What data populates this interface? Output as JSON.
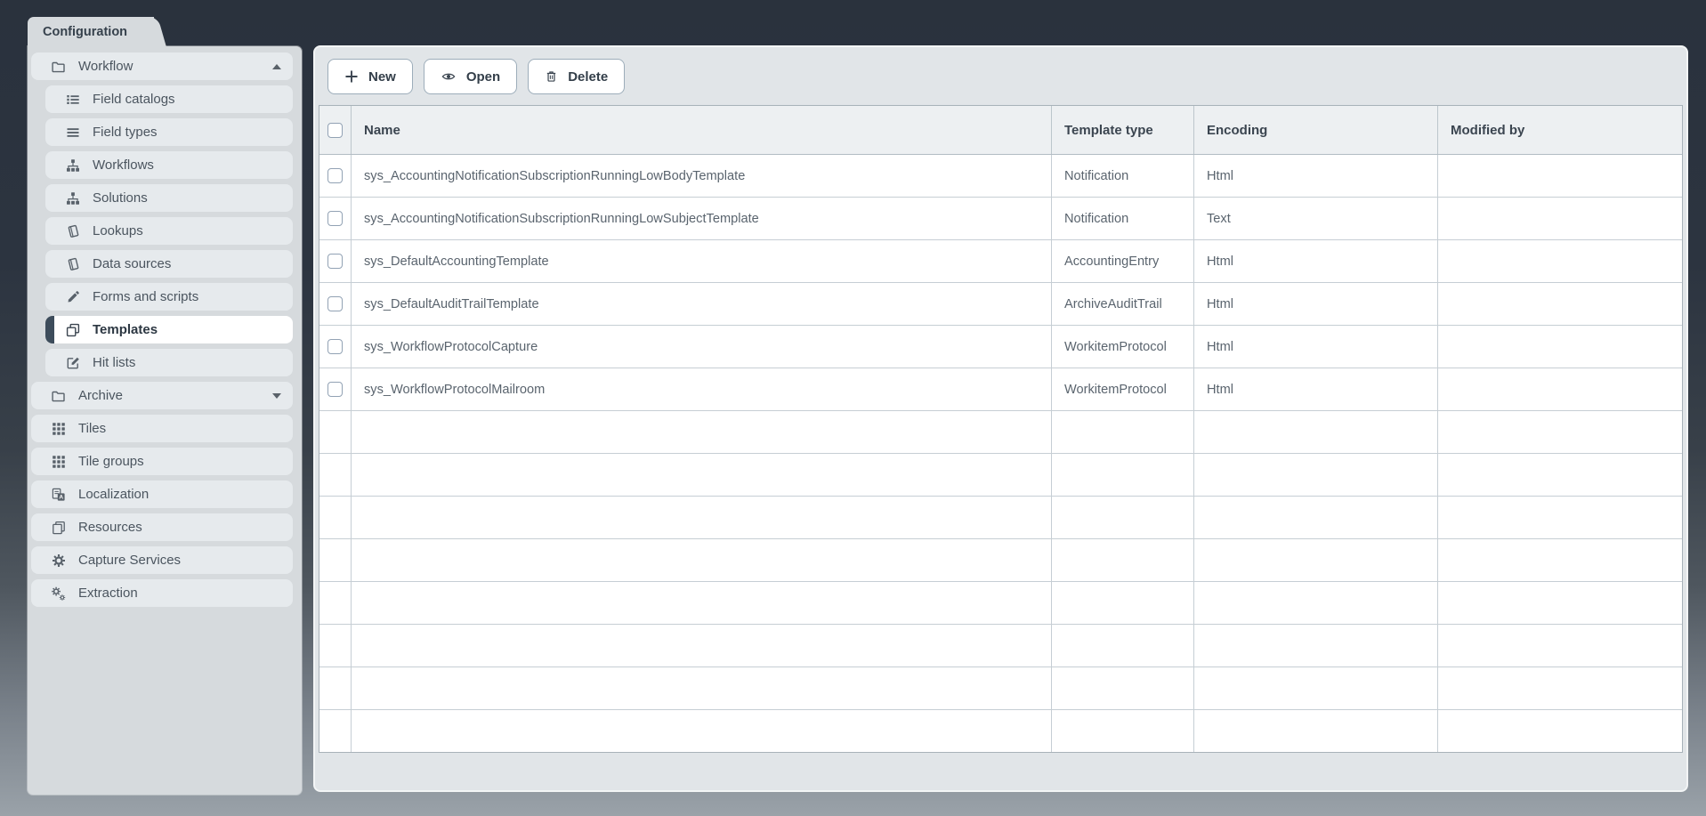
{
  "window": {
    "tab_label": "Configuration"
  },
  "sidebar": {
    "items": [
      {
        "label": "Workflow",
        "icon": "folder-icon",
        "level": 0,
        "chevron": "up"
      },
      {
        "label": "Field catalogs",
        "icon": "field-catalog-icon",
        "level": 1
      },
      {
        "label": "Field types",
        "icon": "lines-icon",
        "level": 1
      },
      {
        "label": "Workflows",
        "icon": "sitemap-icon",
        "level": 1
      },
      {
        "label": "Solutions",
        "icon": "sitemap-icon",
        "level": 1
      },
      {
        "label": "Lookups",
        "icon": "book-icon",
        "level": 1
      },
      {
        "label": "Data sources",
        "icon": "book-icon",
        "level": 1
      },
      {
        "label": "Forms and scripts",
        "icon": "pencil-icon",
        "level": 1
      },
      {
        "label": "Templates",
        "icon": "copy-icon",
        "level": 1,
        "selected": true
      },
      {
        "label": "Hit lists",
        "icon": "edit-square-icon",
        "level": 1
      },
      {
        "label": "Archive",
        "icon": "folder-icon",
        "level": 0,
        "chevron": "down"
      },
      {
        "label": "Tiles",
        "icon": "grid-icon",
        "level": 0
      },
      {
        "label": "Tile groups",
        "icon": "grid-icon",
        "level": 0
      },
      {
        "label": "Localization",
        "icon": "translate-icon",
        "level": 0
      },
      {
        "label": "Resources",
        "icon": "pages-icon",
        "level": 0
      },
      {
        "label": "Capture Services",
        "icon": "gear-icon",
        "level": 0
      },
      {
        "label": "Extraction",
        "icon": "gears-icon",
        "level": 0
      }
    ]
  },
  "toolbar": {
    "buttons": [
      {
        "label": "New",
        "icon": "plus-icon"
      },
      {
        "label": "Open",
        "icon": "eye-icon"
      },
      {
        "label": "Delete",
        "icon": "trash-icon"
      }
    ]
  },
  "table": {
    "columns": [
      "Name",
      "Template type",
      "Encoding",
      "Modified by"
    ],
    "rows": [
      {
        "name": "sys_AccountingNotificationSubscriptionRunningLowBodyTemplate",
        "template_type": "Notification",
        "encoding": "Html",
        "modified_by": ""
      },
      {
        "name": "sys_AccountingNotificationSubscriptionRunningLowSubjectTemplate",
        "template_type": "Notification",
        "encoding": "Text",
        "modified_by": ""
      },
      {
        "name": "sys_DefaultAccountingTemplate",
        "template_type": "AccountingEntry",
        "encoding": "Html",
        "modified_by": ""
      },
      {
        "name": "sys_DefaultAuditTrailTemplate",
        "template_type": "ArchiveAuditTrail",
        "encoding": "Html",
        "modified_by": ""
      },
      {
        "name": "sys_WorkflowProtocolCapture",
        "template_type": "WorkitemProtocol",
        "encoding": "Html",
        "modified_by": ""
      },
      {
        "name": "sys_WorkflowProtocolMailroom",
        "template_type": "WorkitemProtocol",
        "encoding": "Html",
        "modified_by": ""
      }
    ],
    "empty_rows": 8
  },
  "colors": {
    "selection_accent": "#3d4c5b",
    "panel_bg": "#d6dadd",
    "main_bg": "#e1e5e8",
    "sidebar_row_bg": "#e6eaed",
    "table_header_bg": "#edf0f2",
    "table_border": "#c6ced4",
    "page_top": "#2a323d",
    "page_bottom": "#9aa2a9"
  }
}
